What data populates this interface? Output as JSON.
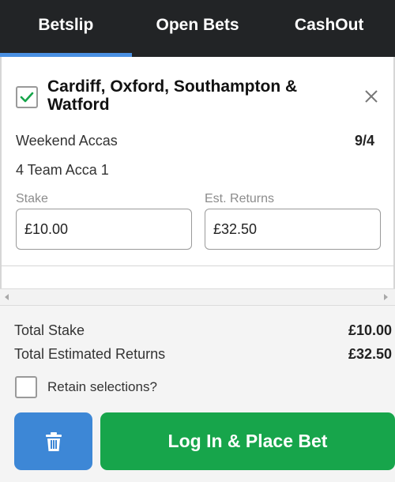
{
  "tabs": [
    {
      "label": "Betslip",
      "active": true
    },
    {
      "label": "Open Bets",
      "active": false
    },
    {
      "label": "CashOut",
      "active": false
    }
  ],
  "selection": {
    "checked": true,
    "title": "Cardiff, Oxford, Southampton & Watford",
    "market": "Weekend Accas",
    "odds": "9/4",
    "bet_name": "4 Team Acca 1",
    "stake_label": "Stake",
    "stake_value": "£10.00",
    "returns_label": "Est. Returns",
    "returns_value": "£32.50"
  },
  "totals": {
    "stake_label": "Total Stake",
    "stake_value": "£10.00",
    "returns_label": "Total Estimated Returns",
    "returns_value": "£32.50"
  },
  "retain": {
    "label": "Retain selections?",
    "checked": false
  },
  "actions": {
    "place_bet_label": "Log In & Place Bet"
  },
  "icons": {
    "checkbox": "check-icon",
    "close": "close-icon",
    "trash": "trash-icon"
  },
  "colors": {
    "tab_bar": "#222426",
    "active_tab": "#4a90e2",
    "check": "#17a54b",
    "delete_button": "#3d87d6",
    "place_button": "#17a54b"
  }
}
